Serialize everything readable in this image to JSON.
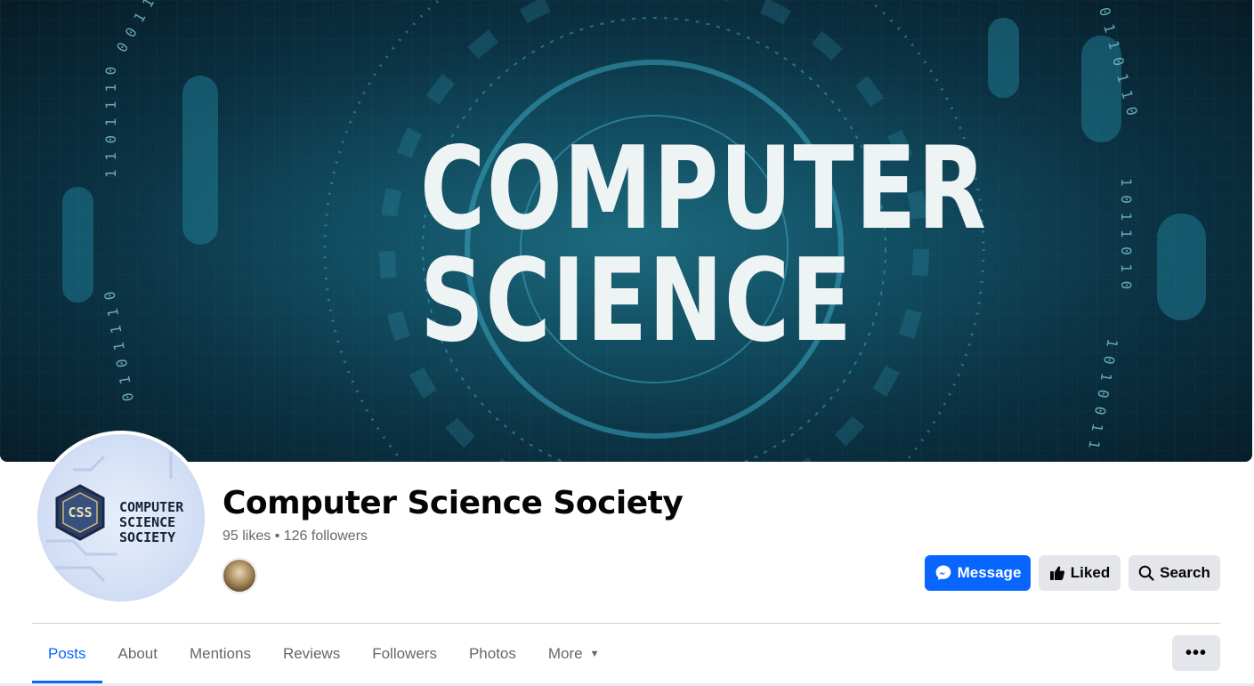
{
  "cover": {
    "line1": "COMPUTER",
    "line2": "SCIENCE"
  },
  "profile": {
    "logo_initials": "CSS",
    "logo_lines": [
      "COMPUTER",
      "SCIENCE",
      "SOCIETY"
    ]
  },
  "page": {
    "title": "Computer Science Society",
    "stats": "95 likes • 126 followers"
  },
  "actions": {
    "message": "Message",
    "liked": "Liked",
    "search": "Search",
    "more_icon": "•••"
  },
  "tabs": [
    {
      "label": "Posts",
      "active": true
    },
    {
      "label": "About"
    },
    {
      "label": "Mentions"
    },
    {
      "label": "Reviews"
    },
    {
      "label": "Followers"
    },
    {
      "label": "Photos"
    },
    {
      "label": "More",
      "icon": "caret-down-icon"
    }
  ],
  "colors": {
    "accent": "#0866ff",
    "button_gray": "#e4e6eb",
    "text_primary": "#050505",
    "text_secondary": "#65676b"
  }
}
